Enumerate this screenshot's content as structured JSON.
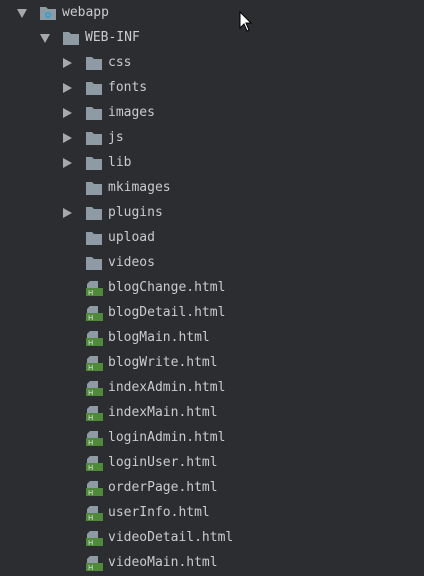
{
  "project_tree": {
    "root": {
      "label": "webapp",
      "icon": "web-folder-icon",
      "expanded": true
    },
    "web_inf": {
      "label": "WEB-INF",
      "icon": "folder-icon",
      "expanded": true
    },
    "folders": [
      {
        "label": "css",
        "collapsed": true
      },
      {
        "label": "fonts",
        "collapsed": true
      },
      {
        "label": "images",
        "collapsed": true
      },
      {
        "label": "js",
        "collapsed": true
      },
      {
        "label": "lib",
        "collapsed": true
      },
      {
        "label": "mkimages",
        "collapsed": false
      },
      {
        "label": "plugins",
        "collapsed": true
      },
      {
        "label": "upload",
        "collapsed": false
      },
      {
        "label": "videos",
        "collapsed": false
      }
    ],
    "files": [
      {
        "label": "blogChange.html"
      },
      {
        "label": "blogDetail.html"
      },
      {
        "label": "blogMain.html"
      },
      {
        "label": "blogWrite.html"
      },
      {
        "label": "indexAdmin.html"
      },
      {
        "label": "indexMain.html"
      },
      {
        "label": "loginAdmin.html"
      },
      {
        "label": "loginUser.html"
      },
      {
        "label": "orderPage.html"
      },
      {
        "label": "userInfo.html"
      },
      {
        "label": "videoDetail.html"
      },
      {
        "label": "videoMain.html"
      }
    ]
  },
  "colors": {
    "background": "#2b2d30",
    "text": "#c8ccd0",
    "folder": "#8e9aa4",
    "html_file_badge": "#4f8a3a"
  }
}
